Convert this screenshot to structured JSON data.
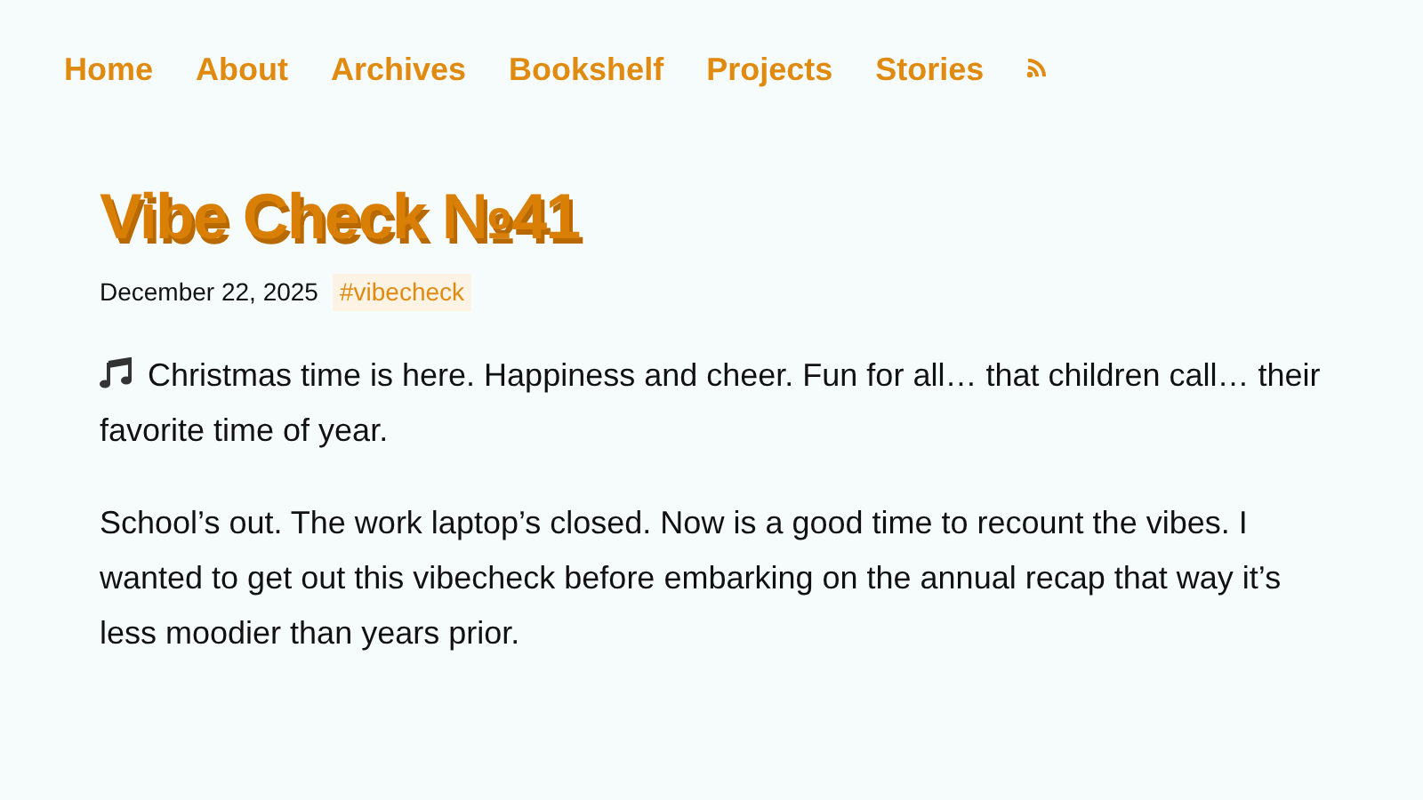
{
  "nav": {
    "links": [
      "Home",
      "About",
      "Archives",
      "Bookshelf",
      "Projects",
      "Stories"
    ]
  },
  "post": {
    "title": "Vibe Check №41",
    "date": "December 22, 2025",
    "tags": [
      "#vibecheck"
    ],
    "paragraphs": [
      {
        "kind": "music",
        "text": "Christmas time is here. Happiness and cheer. Fun for all… that children call… their favorite time of year."
      },
      {
        "kind": "plain",
        "text": "School’s out. The work laptop’s closed. Now is a good time to recount the vibes. I wanted to get out this vibecheck before embarking on the annual recap that way it’s less moodier than years prior."
      }
    ]
  }
}
